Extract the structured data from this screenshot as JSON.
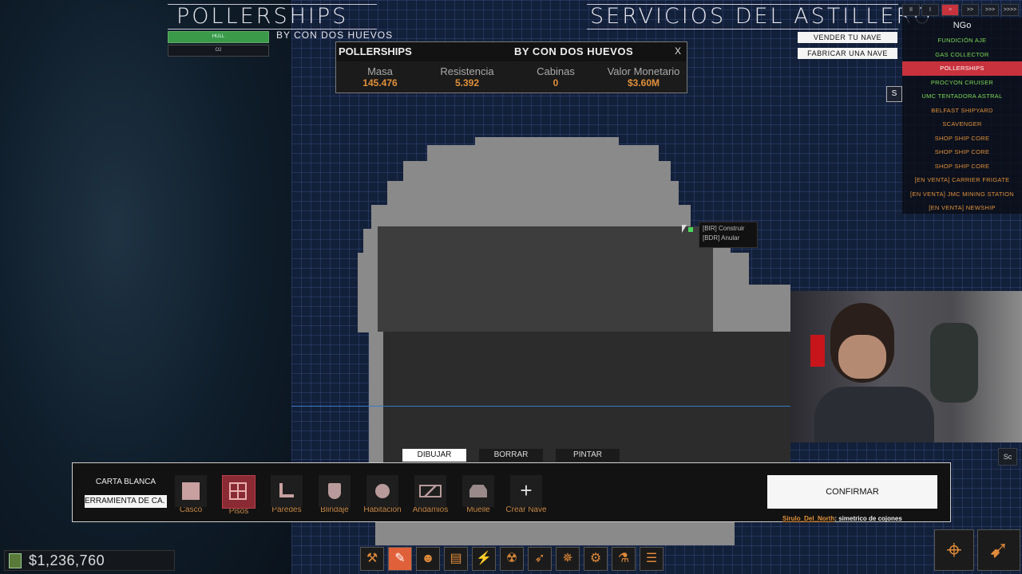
{
  "header": {
    "left_title": "POLLERSHIPS",
    "left_subtitle": "BY CON DOS HUEVOS",
    "hull_label": "HULL",
    "o2_label": "O2",
    "right_title": "SERVICIOS DEL ASTILLERO"
  },
  "actions": {
    "sell": "VENDER TU NAVE",
    "build": "FABRICAR UNA NAVE"
  },
  "topnav": [
    "II",
    "I",
    ">",
    ">>",
    ">>>",
    ">>>>"
  ],
  "shiplist": {
    "header": "NGo",
    "items": [
      {
        "label": "FUNDICIÓN AJE",
        "color": "#7ed957"
      },
      {
        "label": "GAS COLLECTOR",
        "color": "#7ed957"
      },
      {
        "label": "POLLERSHIPS",
        "color": "#ffffff",
        "selected": true
      },
      {
        "label": "PROCYON CRUISER",
        "color": "#7ed957"
      },
      {
        "label": "UMC TENTADORA ASTRAL",
        "color": "#7ed957"
      },
      {
        "label": "BELFAST SHIPYARD",
        "color": "#e0903a"
      },
      {
        "label": "SCAVENGER",
        "color": "#e0903a"
      },
      {
        "label": "SHOP SHIP CORE",
        "color": "#e0903a"
      },
      {
        "label": "SHOP SHIP CORE",
        "color": "#e0903a"
      },
      {
        "label": "SHOP SHIP CORE",
        "color": "#e0903a"
      },
      {
        "label": "[EN VENTA] CARRIER FRIGATE",
        "color": "#e0903a"
      },
      {
        "label": "[EN VENTA] JMC MINING STATION",
        "color": "#e0903a"
      },
      {
        "label": "[EN VENTA] NEWSHIP",
        "color": "#e0903a"
      }
    ],
    "scroll_marker": "S"
  },
  "info": {
    "name": "POLLERSHIPS",
    "author": "BY CON DOS HUEVOS",
    "close": "X",
    "stats": [
      {
        "label": "Masa",
        "value": "145.476"
      },
      {
        "label": "Resistencia",
        "value": "5.392"
      },
      {
        "label": "Cabinas",
        "value": "0"
      },
      {
        "label": "Valor Monetario",
        "value": "$3.60M"
      }
    ]
  },
  "tooltip": {
    "line1": "[BIR] Construir",
    "line2": "[BDR] Anular"
  },
  "tabs": {
    "draw": "DIBUJAR",
    "erase": "BORRAR",
    "paint": "PINTAR"
  },
  "toolbar": {
    "carta_blanca": "CARTA BLANCA",
    "herramienta": "ERRAMIENTA DE CA.",
    "tools": [
      "Casco",
      "Pisos",
      "Paredes",
      "Blindaje",
      "Habitacion",
      "Andamios",
      "Muelle",
      "Crear Nave"
    ],
    "confirm": "CONFIRMAR"
  },
  "chat": {
    "user": "Sirulo_Del_North",
    "message": ": simetrico de cojones"
  },
  "money": "$1,236,760",
  "side_button": "Sc",
  "colors": {
    "accent": "#e0903a",
    "selected": "#c8323c",
    "green": "#7ed957"
  }
}
